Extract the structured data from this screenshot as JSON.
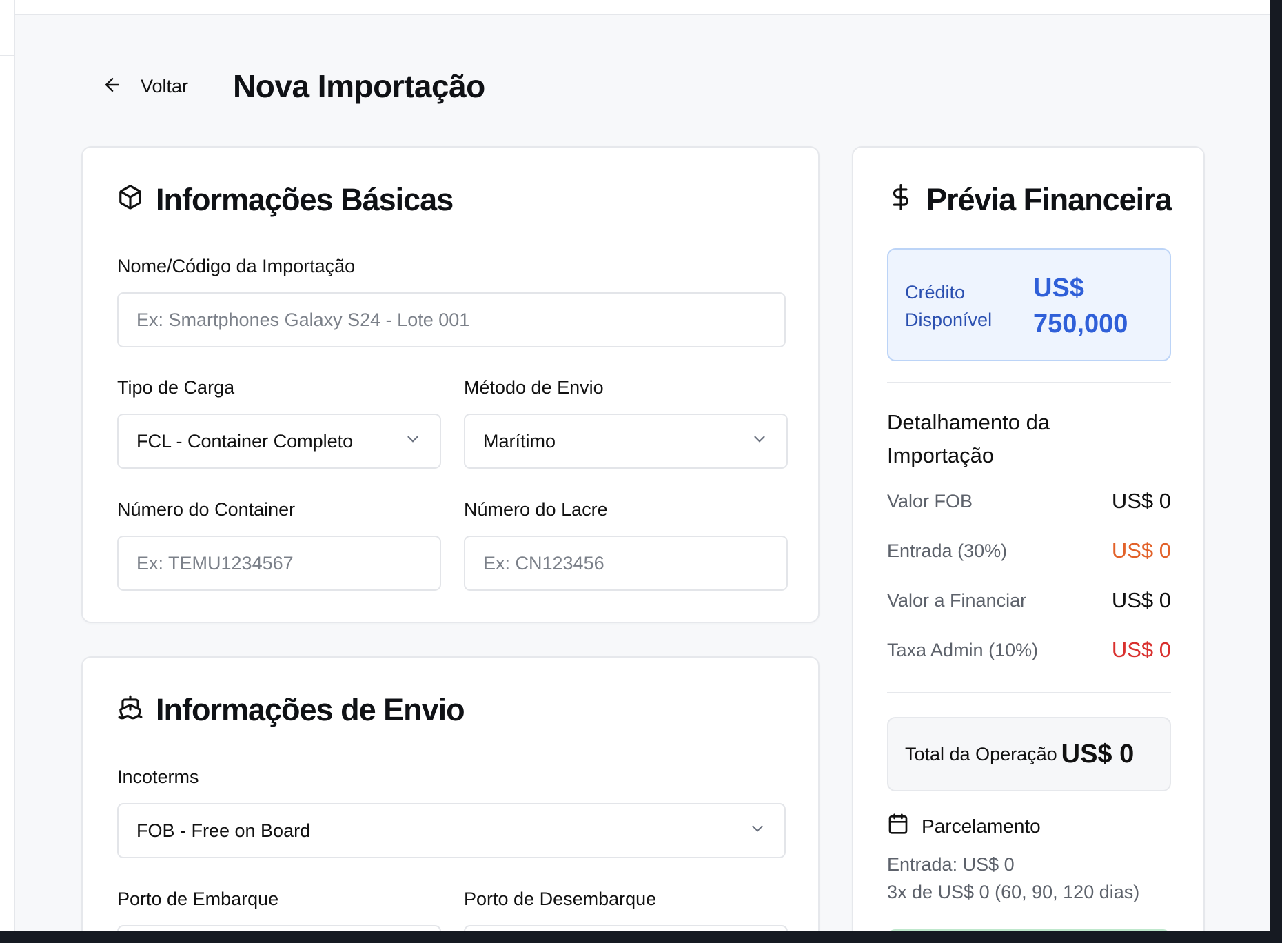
{
  "header": {
    "back_label": "Voltar",
    "title": "Nova Importação"
  },
  "basic": {
    "title": "Informações Básicas",
    "name_label": "Nome/Código da Importação",
    "name_placeholder": "Ex: Smartphones Galaxy S24 - Lote 001",
    "cargo_label": "Tipo de Carga",
    "cargo_value": "FCL - Container Completo",
    "method_label": "Método de Envio",
    "method_value": "Marítimo",
    "container_label": "Número do Container",
    "container_placeholder": "Ex: TEMU1234567",
    "seal_label": "Número do Lacre",
    "seal_placeholder": "Ex: CN123456"
  },
  "envio": {
    "title": "Informações de Envio",
    "incoterms_label": "Incoterms",
    "incoterms_value": "FOB - Free on Board",
    "port_origin_label": "Porto de Embarque",
    "port_dest_label": "Porto de Desembarque"
  },
  "finance": {
    "title": "Prévia Financeira",
    "credit_label": "Crédito Disponível",
    "credit_value": "US$ 750,000",
    "detail_title": "Detalhamento da Importação",
    "rows": [
      {
        "label": "Valor FOB",
        "value": "US$ 0"
      },
      {
        "label": "Entrada (30%)",
        "value": "US$ 0"
      },
      {
        "label": "Valor a Financiar",
        "value": "US$ 0"
      },
      {
        "label": "Taxa Admin (10%)",
        "value": "US$ 0"
      }
    ],
    "total_label": "Total da Operação",
    "total_value": "US$ 0",
    "parcelamento_title": "Parcelamento",
    "parcelamento_entry": "Entrada: US$ 0",
    "parcelamento_installments": "3x de US$ 0 (60, 90, 120 dias)",
    "colors": {
      "accent": "#2f5fd8",
      "orange": "#e2622a",
      "red": "#d9302e"
    }
  }
}
